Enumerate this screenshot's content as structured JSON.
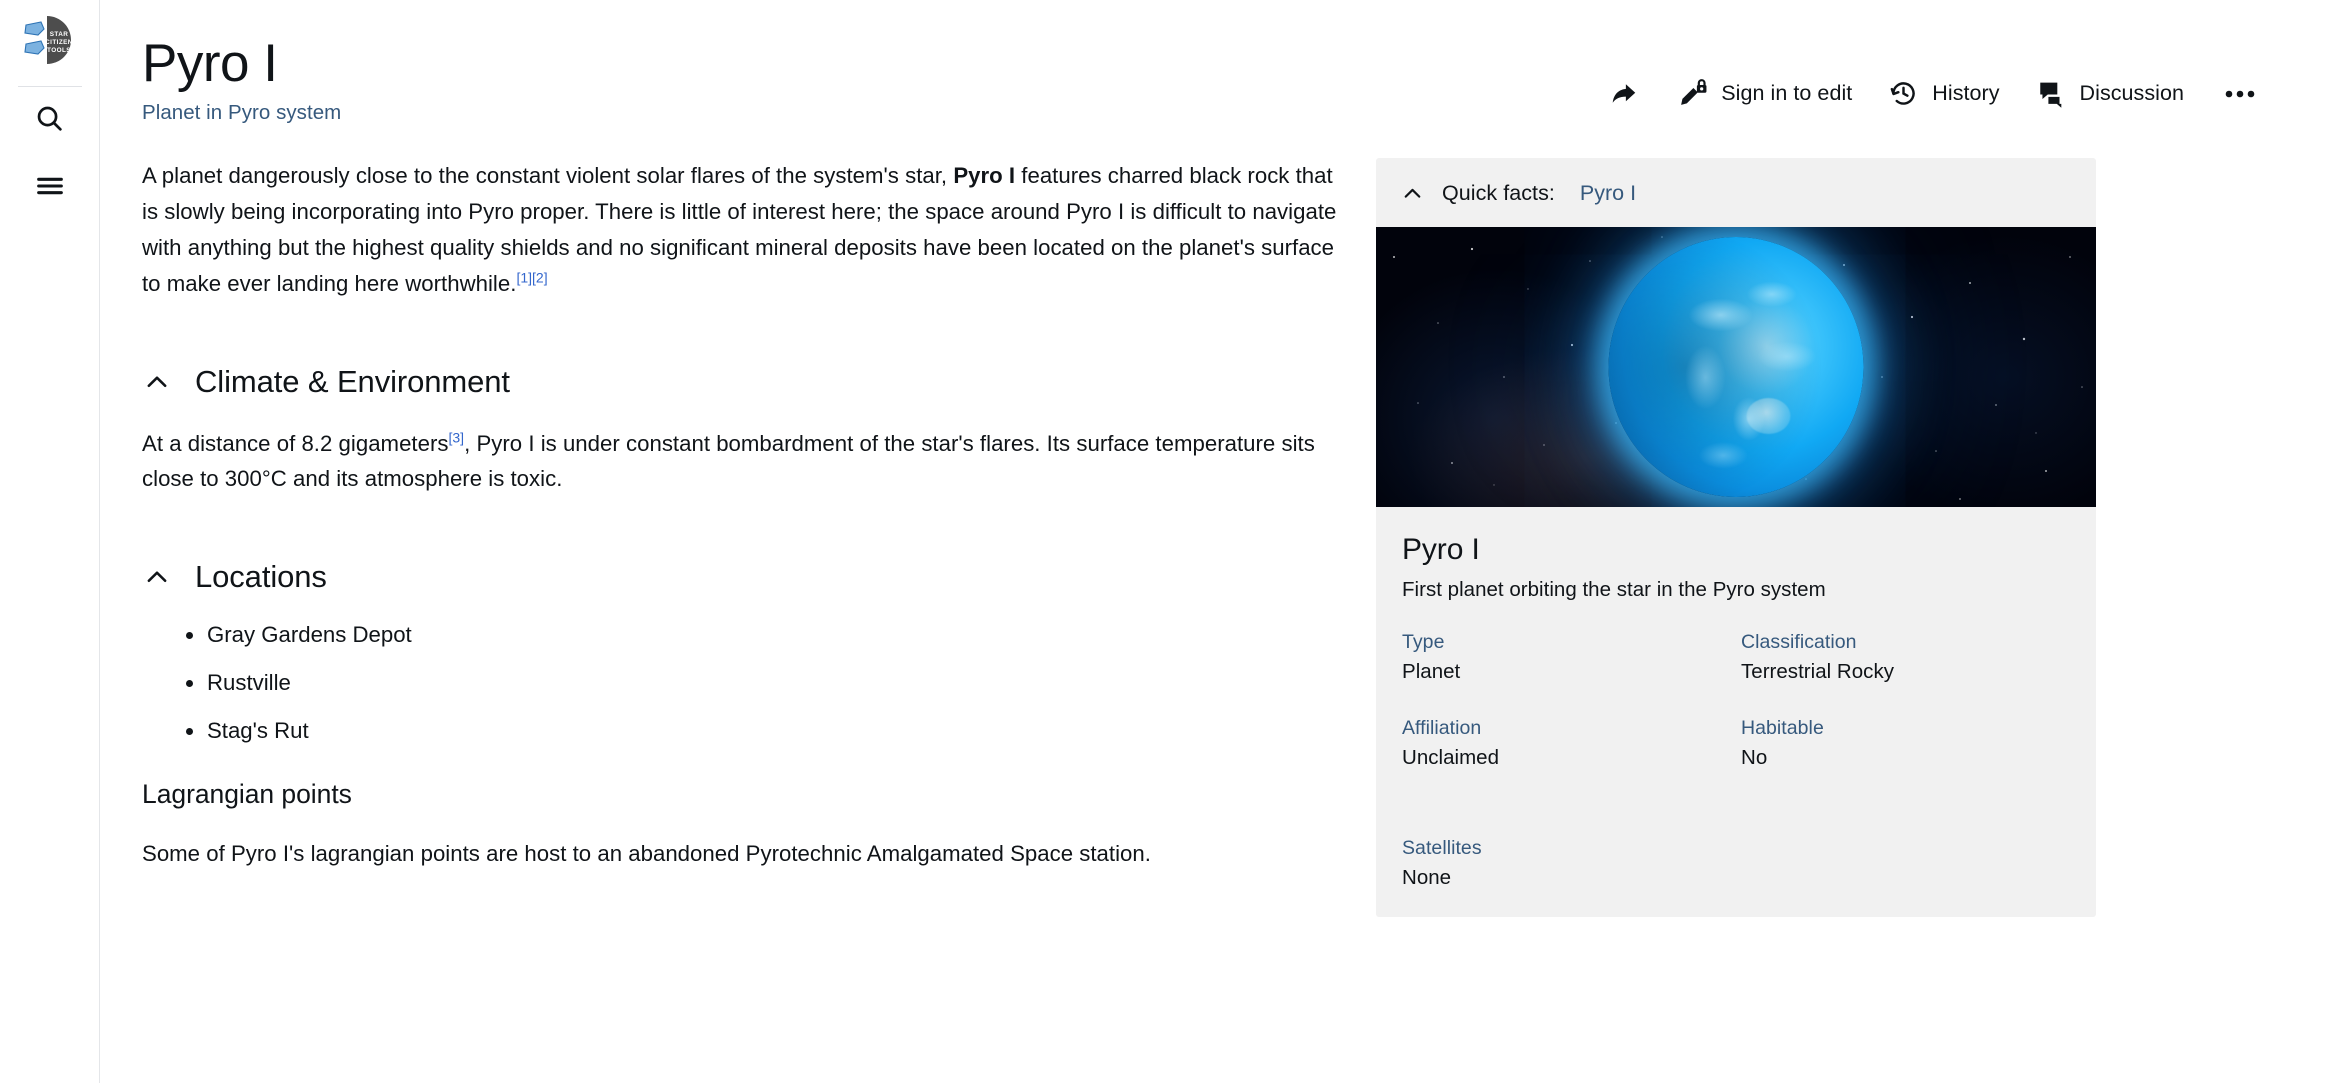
{
  "sidebar": {
    "logo": {
      "name": "star-citizen-tools-logo",
      "line1": "STAR",
      "line2": "CITIZEN",
      "line3": "TOOLS"
    },
    "search_icon": "search-icon",
    "menu_icon": "hamburger-menu-icon"
  },
  "header": {
    "title": "Pyro I",
    "subtitle": "Planet in Pyro system",
    "actions": [
      {
        "icon": "share-icon",
        "label": ""
      },
      {
        "icon": "pencil-lock-icon",
        "label": "Sign in to edit"
      },
      {
        "icon": "history-clock-icon",
        "label": "History"
      },
      {
        "icon": "discussion-bubble-icon",
        "label": "Discussion"
      },
      {
        "icon": "ellipsis-icon",
        "label": ""
      }
    ]
  },
  "article": {
    "intro": {
      "part1": "A planet dangerously close to the constant violent solar flares of the system's star, ",
      "bold": "Pyro I",
      "part2": " features charred black rock that is slowly being incorporating into Pyro proper. There is little of interest here; the space around Pyro I is difficult to navigate with anything but the highest quality shields and no significant mineral deposits have been located on the planet's surface to make ever landing here worthwhile.",
      "ref1": "[1]",
      "ref2": "[2]"
    },
    "sections": [
      {
        "heading": "Climate & Environment",
        "text_part1": "At a distance of 8.2 gigameters",
        "ref": "[3]",
        "text_part2": ", Pyro I is under constant bombardment of the star's flares. Its surface temperature sits close to 300°C and its atmosphere is toxic."
      },
      {
        "heading": "Locations",
        "items": [
          "Gray Gardens Depot",
          "Rustville",
          "Stag's Rut"
        ],
        "subheading": "Lagrangian points",
        "subtext": "Some of Pyro I's lagrangian points are host to an abandoned Pyrotechnic Amalgamated Space station."
      }
    ]
  },
  "infobox": {
    "quick_facts_label": "Quick facts:",
    "quick_facts_link": "Pyro I",
    "image_alt": "planet-image",
    "title": "Pyro I",
    "description": "First planet orbiting the star in the Pyro system",
    "fields": [
      {
        "label": "Type",
        "value": "Planet"
      },
      {
        "label": "Classification",
        "value": "Terrestrial Rocky"
      },
      {
        "label": "Affiliation",
        "value": "Unclaimed"
      },
      {
        "label": "Habitable",
        "value": "No"
      },
      {
        "label": "Satellites",
        "value": "None"
      }
    ]
  },
  "colors": {
    "link": "#36597d",
    "ref_link": "#3366cc",
    "text": "#101418",
    "infobox_bg": "#f1f1f1",
    "planet_accent": "#11a9f4"
  }
}
